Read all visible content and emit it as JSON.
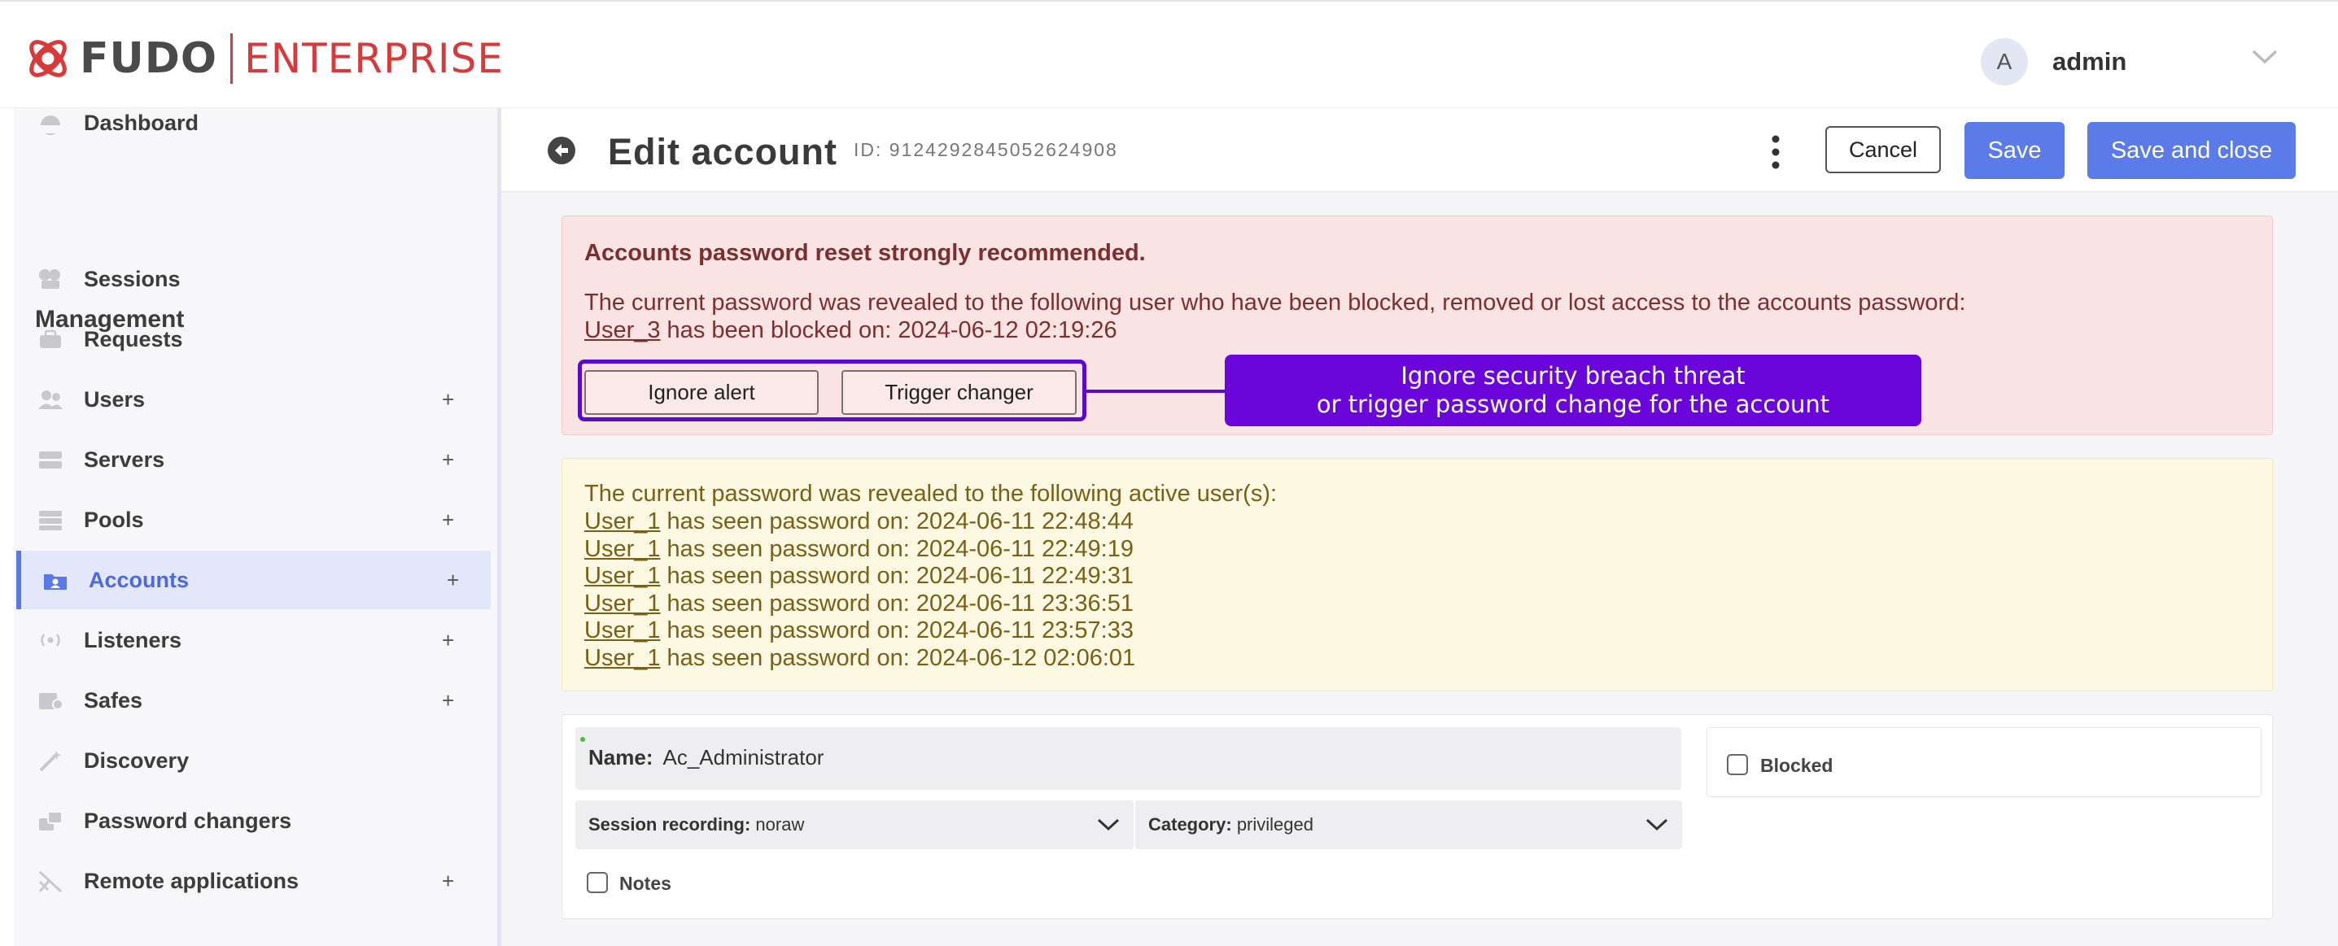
{
  "app": {
    "logo_left": "FUDO",
    "logo_right": "ENTERPRISE",
    "user_avatar": "A",
    "username": "admin"
  },
  "sidebar": {
    "section_title": "Management",
    "items": [
      {
        "label": "Dashboard",
        "icon": "dashboard-icon",
        "plus": ""
      },
      {
        "label": "Sessions",
        "icon": "sessions-icon",
        "plus": ""
      },
      {
        "label": "Requests",
        "icon": "requests-icon",
        "plus": ""
      },
      {
        "label": "Users",
        "icon": "users-icon",
        "plus": "+"
      },
      {
        "label": "Servers",
        "icon": "servers-icon",
        "plus": "+"
      },
      {
        "label": "Pools",
        "icon": "pools-icon",
        "plus": "+"
      },
      {
        "label": "Accounts",
        "icon": "accounts-icon",
        "plus": "+",
        "active": true
      },
      {
        "label": "Listeners",
        "icon": "listeners-icon",
        "plus": "+"
      },
      {
        "label": "Safes",
        "icon": "safes-icon",
        "plus": "+"
      },
      {
        "label": "Discovery",
        "icon": "discovery-icon",
        "plus": ""
      },
      {
        "label": "Password changers",
        "icon": "password-changers-icon",
        "plus": ""
      },
      {
        "label": "Remote applications",
        "icon": "remote-applications-icon",
        "plus": "+"
      }
    ]
  },
  "header": {
    "title": "Edit account",
    "id_text": "ID: 9124292845052624908",
    "cancel_label": "Cancel",
    "save_label": "Save",
    "save_close_label": "Save and close"
  },
  "alert_red": {
    "title": "Accounts password reset strongly recommended.",
    "message": "The current password was revealed to the following user who have been blocked, removed or lost access to the accounts password:",
    "user": "User_3",
    "blocked_text": " has been blocked on: 2024-06-12 02:19:26",
    "ignore_label": "Ignore alert",
    "trigger_label": "Trigger changer",
    "callout_line1": "Ignore security breach threat",
    "callout_line2": "or trigger password change for the account"
  },
  "alert_yellow": {
    "message": "The current password was revealed to the following active user(s):",
    "entries": [
      {
        "user": "User_1",
        "text": " has seen password on: 2024-06-11 22:48:44"
      },
      {
        "user": "User_1",
        "text": " has seen password on: 2024-06-11 22:49:19"
      },
      {
        "user": "User_1",
        "text": " has seen password on: 2024-06-11 22:49:31"
      },
      {
        "user": "User_1",
        "text": " has seen password on: 2024-06-11 23:36:51"
      },
      {
        "user": "User_1",
        "text": " has seen password on: 2024-06-11 23:57:33"
      },
      {
        "user": "User_1",
        "text": " has seen password on: 2024-06-12 02:06:01"
      }
    ]
  },
  "form": {
    "name_label": "Name:",
    "name_value": "Ac_Administrator",
    "blocked_label": "Blocked",
    "session_recording_label": "Session recording:",
    "session_recording_value": "noraw",
    "category_label": "Category:",
    "category_value": "privileged",
    "notes_label": "Notes"
  },
  "colors": {
    "accent": "#5b7be9",
    "callout": "#6b06db",
    "brand_red": "#d63a3a"
  }
}
